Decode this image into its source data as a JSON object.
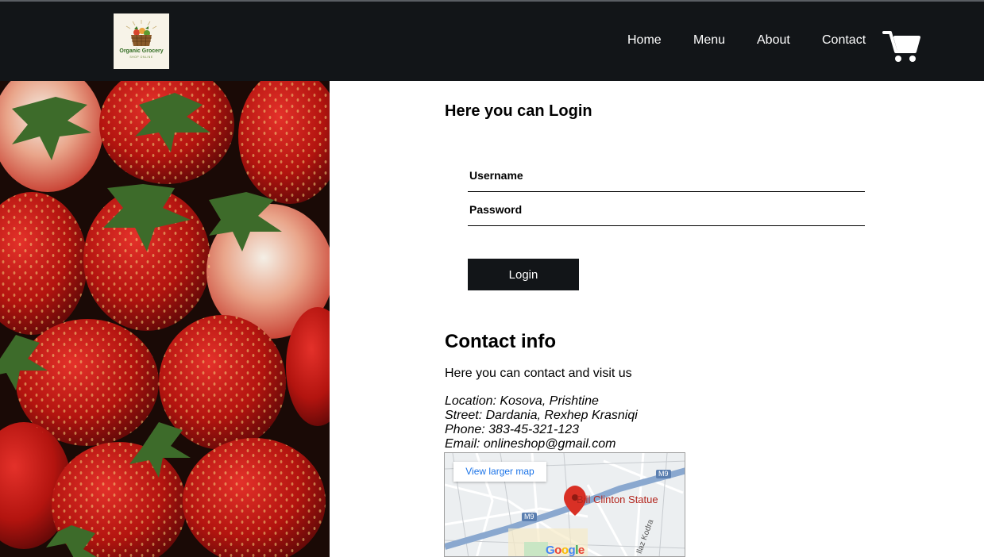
{
  "nav": {
    "logo_title": "Organic Grocery",
    "logo_subtitle": "SHOP ONLINE",
    "links": [
      "Home",
      "Menu",
      "About",
      "Contact"
    ],
    "cart_icon": "shopping-cart-icon"
  },
  "login": {
    "title": "Here you can Login",
    "username_placeholder": "Username",
    "password_placeholder": "Password",
    "button_label": "Login"
  },
  "contact": {
    "title": "Contact info",
    "subtitle": "Here you can contact and visit us",
    "location": "Location: Kosova, Prishtine",
    "street": "Street: Dardania, Rexhep Krasniqi",
    "phone": "Phone: 383-45-321-123",
    "email": "Email: onlineshop@gmail.com"
  },
  "map": {
    "view_larger": "View larger map",
    "place_label": "Bill Clinton Statue",
    "road_badge_1": "M9",
    "road_badge_2": "M9",
    "street_label": "Ilaz Kodra",
    "google": "Google"
  },
  "colors": {
    "navbar": "#121518",
    "button": "#121518",
    "marker": "#d93025"
  }
}
